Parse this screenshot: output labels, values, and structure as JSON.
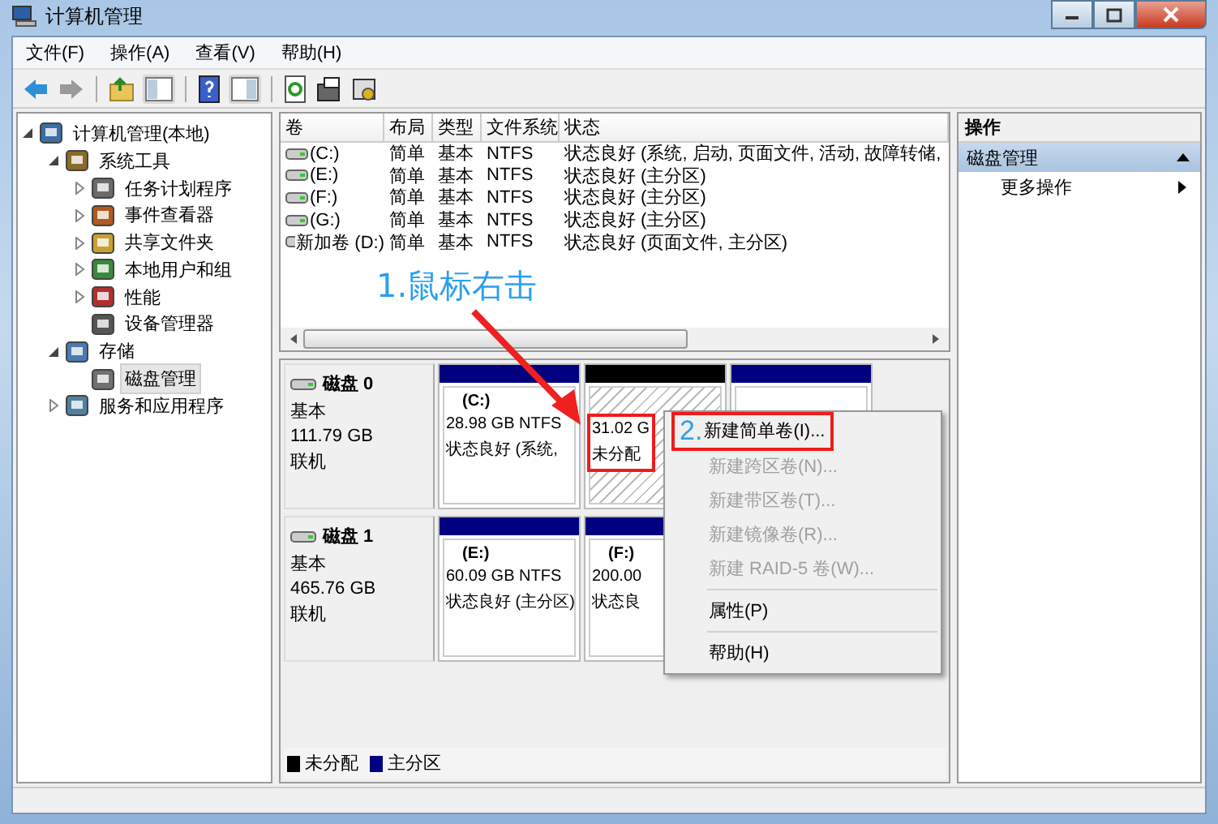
{
  "window": {
    "title": "计算机管理"
  },
  "menu_bar": [
    "文件(F)",
    "操作(A)",
    "查看(V)",
    "帮助(H)"
  ],
  "tree": [
    {
      "label": "计算机管理(本地)",
      "expanded": true,
      "selected": false,
      "children": [
        {
          "label": "系统工具",
          "expanded": true,
          "selected": false,
          "children": [
            {
              "label": "任务计划程序",
              "expanded": false,
              "selected": false
            },
            {
              "label": "事件查看器",
              "expanded": false,
              "selected": false
            },
            {
              "label": "共享文件夹",
              "expanded": false,
              "selected": false
            },
            {
              "label": "本地用户和组",
              "expanded": false,
              "selected": false
            },
            {
              "label": "性能",
              "expanded": false,
              "selected": false
            },
            {
              "label": "设备管理器",
              "selected": false
            }
          ]
        },
        {
          "label": "存储",
          "expanded": true,
          "selected": false,
          "children": [
            {
              "label": "磁盘管理",
              "selected": true
            }
          ]
        },
        {
          "label": "服务和应用程序",
          "expanded": false,
          "selected": false
        }
      ]
    }
  ],
  "volumes": {
    "columns": [
      "卷",
      "布局",
      "类型",
      "文件系统",
      "状态"
    ],
    "rows": [
      [
        "(C:)",
        "简单",
        "基本",
        "NTFS",
        "状态良好 (系统, 启动, 页面文件, 活动, 故障转储,"
      ],
      [
        "(E:)",
        "简单",
        "基本",
        "NTFS",
        "状态良好 (主分区)"
      ],
      [
        "(F:)",
        "简单",
        "基本",
        "NTFS",
        "状态良好 (主分区)"
      ],
      [
        "(G:)",
        "简单",
        "基本",
        "NTFS",
        "状态良好 (主分区)"
      ],
      [
        "新加卷 (D:)",
        "简单",
        "基本",
        "NTFS",
        "状态良好 (页面文件, 主分区)"
      ]
    ]
  },
  "disks": [
    {
      "name": "磁盘 0",
      "type": "基本",
      "size": "111.79 GB",
      "status": "联机",
      "partitions": [
        {
          "kind": "primary",
          "label": "(C:)",
          "size": "28.98 GB NTFS",
          "status": "状态良好 (系统,",
          "annotated": false
        },
        {
          "kind": "unallocated",
          "size": "31.02 G",
          "status": "未分配",
          "annotated": true
        },
        {
          "kind": "primary",
          "annotated": false
        }
      ]
    },
    {
      "name": "磁盘 1",
      "type": "基本",
      "size": "465.76 GB",
      "status": "联机",
      "partitions": [
        {
          "kind": "primary",
          "label": "(E:)",
          "size": "60.09 GB NTFS",
          "status": "状态良好 (主分区)",
          "annotated": false
        },
        {
          "kind": "primary",
          "label": "(F:)",
          "size": "200.00",
          "status": "状态良",
          "annotated": false
        }
      ]
    }
  ],
  "legend": [
    {
      "label": "未分配",
      "color": "#000000"
    },
    {
      "label": "主分区",
      "color": "#000080"
    }
  ],
  "actions": {
    "title": "操作",
    "section": {
      "label": "磁盘管理",
      "expanded": true
    },
    "items": [
      "更多操作"
    ]
  },
  "context_menu": [
    {
      "kind": "item",
      "label": "新建简单卷(I)...",
      "disabled": false,
      "annotated": true
    },
    {
      "kind": "item",
      "label": "新建跨区卷(N)...",
      "disabled": true,
      "annotated": false
    },
    {
      "kind": "item",
      "label": "新建带区卷(T)...",
      "disabled": true,
      "annotated": false
    },
    {
      "kind": "item",
      "label": "新建镜像卷(R)...",
      "disabled": true,
      "annotated": false
    },
    {
      "kind": "item",
      "label": "新建 RAID-5 卷(W)...",
      "disabled": true,
      "annotated": false
    },
    {
      "kind": "separator"
    },
    {
      "kind": "item",
      "label": "属性(P)",
      "disabled": false,
      "annotated": false
    },
    {
      "kind": "separator"
    },
    {
      "kind": "item",
      "label": "帮助(H)",
      "disabled": false,
      "annotated": false
    }
  ],
  "annotations": {
    "step_1": "1.鼠标右击",
    "step_2": "2."
  }
}
